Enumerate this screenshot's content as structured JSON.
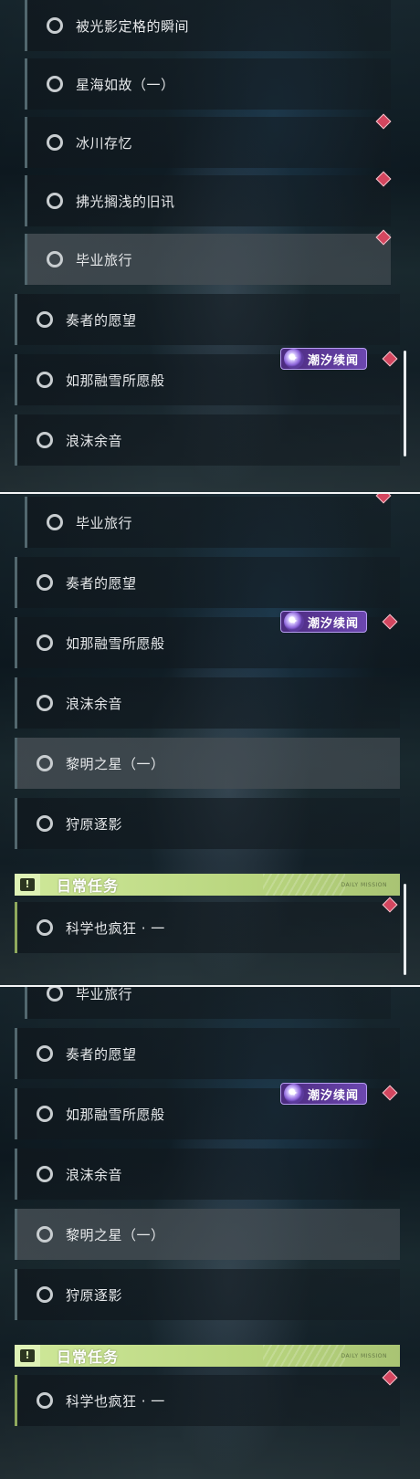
{
  "panels": [
    {
      "quests": [
        {
          "label": "被光影定格的瞬间"
        },
        {
          "label": "星海如故（一）"
        },
        {
          "label": "冰川存忆"
        },
        {
          "label": "拂光搁浅的旧讯"
        },
        {
          "label": "毕业旅行"
        },
        {
          "label": "奏者的愿望"
        },
        {
          "label": "如那融雪所愿般"
        },
        {
          "label": "浪沫余音"
        }
      ]
    },
    {
      "quests": [
        {
          "label": "毕业旅行"
        },
        {
          "label": "奏者的愿望"
        },
        {
          "label": "如那融雪所愿般"
        },
        {
          "label": "浪沫余音"
        },
        {
          "label": "黎明之星（一）"
        },
        {
          "label": "狩原逐影"
        },
        {
          "label": "科学也疯狂 · 一"
        }
      ]
    },
    {
      "quests": [
        {
          "label": "毕业旅行"
        },
        {
          "label": "奏者的愿望"
        },
        {
          "label": "如那融雪所愿般"
        },
        {
          "label": "浪沫余音"
        },
        {
          "label": "黎明之星（一）"
        },
        {
          "label": "狩原逐影"
        },
        {
          "label": "科学也疯狂 · 一"
        }
      ]
    }
  ],
  "badge": {
    "label": "潮汐续闻",
    "icon": "star-sparkle-icon"
  },
  "daily_section": {
    "title": "日常任务",
    "subtitle": "DAILY MISSION",
    "icon": "warning-icon"
  },
  "colors": {
    "marker": "#d4465f",
    "badge": "#6c47b0",
    "daily_accent": "#cfe89a",
    "row_accent": "#52676e"
  }
}
